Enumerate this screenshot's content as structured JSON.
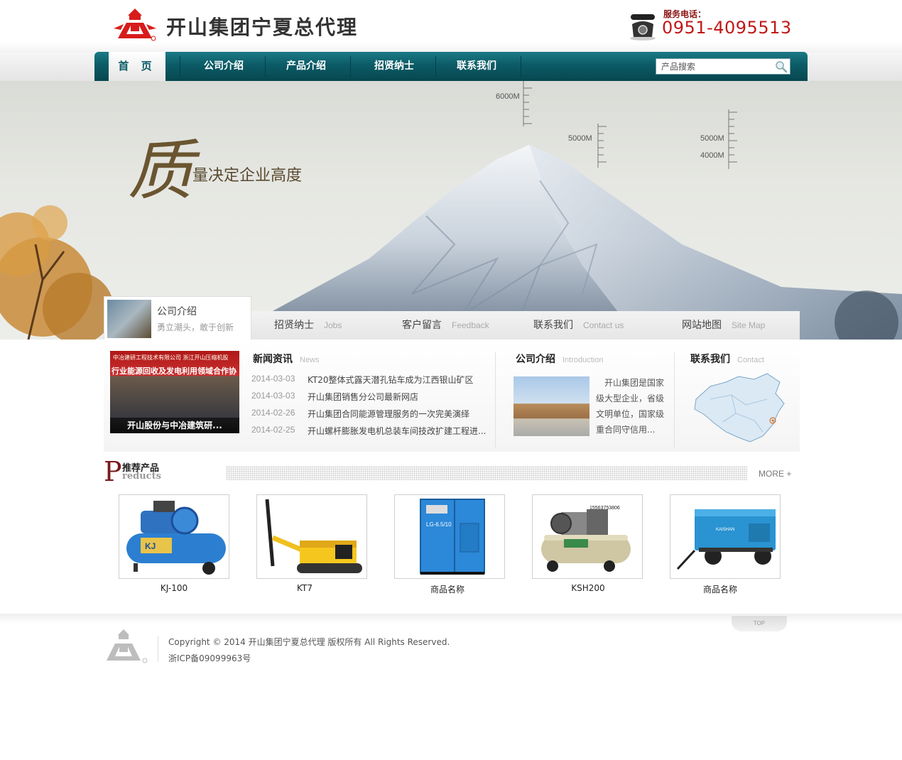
{
  "header": {
    "site_title": "开山集团宁夏总代理",
    "phone_label": "服务电话：",
    "phone_number": "0951-4095513"
  },
  "nav": {
    "items": [
      "首 页",
      "公司介绍",
      "产品介绍",
      "招贤纳士",
      "联系我们"
    ],
    "search_placeholder": "产品搜索"
  },
  "banner": {
    "slogan_char": "质",
    "slogan_text": "量决定企业高度",
    "altitudes": [
      "6000M",
      "5000M",
      "5000M",
      "4000M"
    ]
  },
  "banner_tabs": {
    "active": {
      "title": "公司介绍",
      "subtitle": "勇立潮头，敢于创新"
    },
    "tabs": [
      {
        "cn": "招贤纳士",
        "en": "Jobs"
      },
      {
        "cn": "客户留言",
        "en": "Feedback"
      },
      {
        "cn": "联系我们",
        "en": "Contact us"
      },
      {
        "cn": "网站地图",
        "en": "Site Map"
      }
    ]
  },
  "news": {
    "title": "新闻资讯",
    "title_en": "News",
    "photo_caption": "开山股份与中冶建筑研...",
    "photo_banner_line1": "中冶建研工程技术有限公司  浙江开山压缩机股",
    "photo_banner_line2": "行业能源回收及发电利用领域合作协",
    "items": [
      {
        "date": "2014-03-03",
        "title": "KT20整体式露天潜孔钻车成为江西银山矿区"
      },
      {
        "date": "2014-03-03",
        "title": "开山集团销售分公司最新网店"
      },
      {
        "date": "2014-02-26",
        "title": "开山集团合同能源管理服务的一次完美演绎"
      },
      {
        "date": "2014-02-25",
        "title": "开山螺杆膨胀发电机总装车间技改扩建工程进..."
      }
    ]
  },
  "intro": {
    "title": "公司介绍",
    "title_en": "Introduction",
    "text": "开山集团是国家级大型企业，省级文明单位，国家级重合同守信用..."
  },
  "contact": {
    "title": "联系我们",
    "title_en": "Contact"
  },
  "products": {
    "heading_letter": "P",
    "heading_cn": "推荐产品",
    "heading_en": "reducts",
    "more": "MORE +",
    "items": [
      {
        "name": "KJ-100",
        "image": "air-compressor-blue"
      },
      {
        "name": "KT7",
        "image": "drill-rig-yellow"
      },
      {
        "name": "商品名称",
        "image": "screw-compressor-cabinet"
      },
      {
        "name": "KSH200",
        "image": "air-compressor-beige"
      },
      {
        "name": "商品名称",
        "image": "portable-compressor-trailer"
      }
    ],
    "photo_text": [
      "KJ",
      "LG-6.5/10",
      "15563753806",
      "KAISHAN"
    ]
  },
  "footer": {
    "top": "TOP",
    "copyright": "Copyright © 2014 开山集团宁夏总代理 版权所有 All Rights Reserved.",
    "icp": "浙ICP备09099963号"
  },
  "colors": {
    "nav": "#0b5b66",
    "brand_red": "#c01818",
    "logo_red": "#d81c1c"
  }
}
